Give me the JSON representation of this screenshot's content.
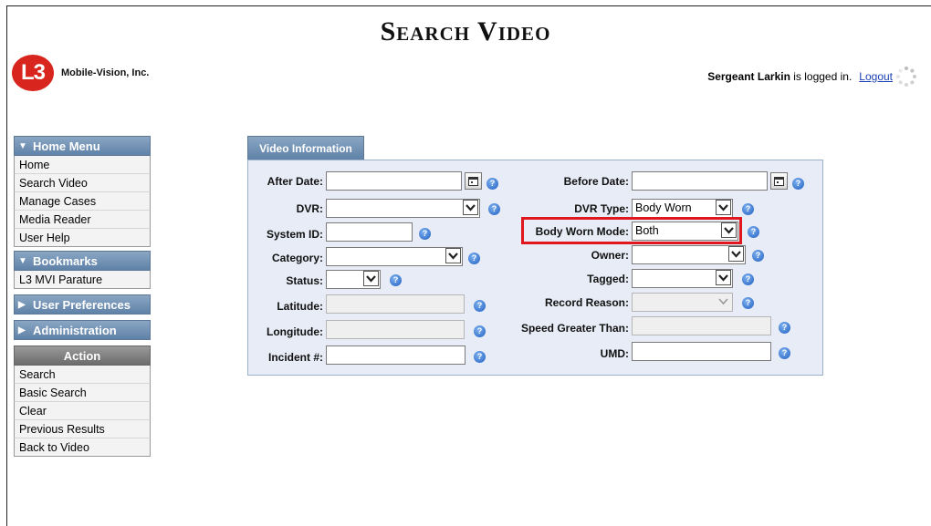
{
  "header": {
    "title": "Search Video",
    "logo_mark": "L3",
    "logo_text": "Mobile-Vision, Inc.",
    "user_name": "Sergeant Larkin",
    "logged_in_text": " is logged in.",
    "logout_label": "Logout"
  },
  "sidebar": {
    "home_menu": {
      "label": "Home Menu",
      "items": [
        "Home",
        "Search Video",
        "Manage Cases",
        "Media Reader",
        "User Help"
      ]
    },
    "bookmarks": {
      "label": "Bookmarks",
      "items": [
        "L3 MVI Parature"
      ]
    },
    "user_preferences_label": "User Preferences",
    "administration_label": "Administration",
    "action": {
      "label": "Action",
      "items": [
        "Search",
        "Basic Search",
        "Clear",
        "Previous Results",
        "Back to Video"
      ]
    }
  },
  "panel": {
    "tab_label": "Video Information",
    "left": {
      "after_date": {
        "label": "After Date:",
        "value": ""
      },
      "dvr": {
        "label": "DVR:",
        "value": ""
      },
      "system_id": {
        "label": "System ID:",
        "value": ""
      },
      "category": {
        "label": "Category:",
        "value": ""
      },
      "status": {
        "label": "Status:",
        "value": ""
      },
      "latitude": {
        "label": "Latitude:",
        "value": ""
      },
      "longitude": {
        "label": "Longitude:",
        "value": ""
      },
      "incident": {
        "label": "Incident #:",
        "value": ""
      }
    },
    "right": {
      "before_date": {
        "label": "Before Date:",
        "value": ""
      },
      "dvr_type": {
        "label": "DVR Type:",
        "value": "Body Worn"
      },
      "body_worn_mode": {
        "label": "Body Worn Mode:",
        "value": "Both"
      },
      "owner": {
        "label": "Owner:",
        "value": ""
      },
      "tagged": {
        "label": "Tagged:",
        "value": ""
      },
      "record_reason": {
        "label": "Record Reason:",
        "value": ""
      },
      "speed": {
        "label": "Speed Greater Than:",
        "value": ""
      },
      "umd": {
        "label": "UMD:",
        "value": ""
      }
    }
  },
  "colors": {
    "menu_header": "#6f8fb3",
    "highlight": "#e0181e",
    "panel_bg": "#e7ecf6",
    "logo_red": "#d8251d"
  },
  "icons": {
    "help": "help-icon",
    "calendar": "calendar-icon",
    "dropdown": "chevron-down-icon",
    "spinner": "loading-spinner-icon"
  }
}
